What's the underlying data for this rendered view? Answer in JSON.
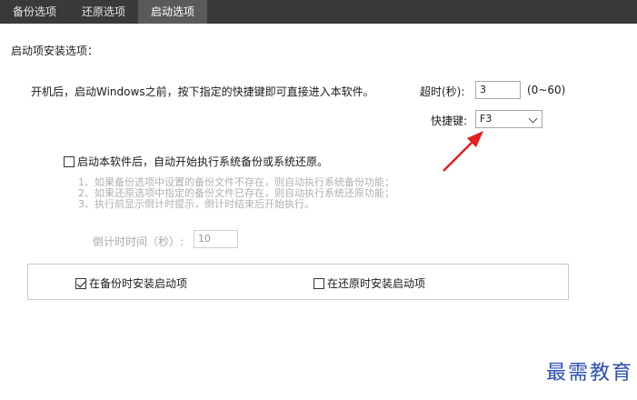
{
  "tabs": [
    {
      "label": "备份选项"
    },
    {
      "label": "还原选项"
    },
    {
      "label": "启动选项"
    }
  ],
  "section_title": "启动项安装选项：",
  "description": "开机后，启动Windows之前，按下指定的快捷键即可直接进入本软件。",
  "timeout": {
    "label": "超时(秒):",
    "value": "3",
    "range": "(0~60)"
  },
  "hotkey": {
    "label": "快捷键:",
    "value": "F3"
  },
  "auto_exec": {
    "label": "启动本软件后，自动开始执行系统备份或系统还原。",
    "checked": false
  },
  "notes": [
    "1、如果备份选项中设置的备份文件不存在，则自动执行系统备份功能；",
    "2、如果还原选项中指定的备份文件已存在，则自动执行系统还原功能；",
    "3、执行前显示倒计时提示，倒计时结束后开始执行。"
  ],
  "countdown": {
    "label": "倒计时时间（秒）:",
    "value": "10"
  },
  "install_on_backup": {
    "label": "在备份时安装启动项",
    "checked": true
  },
  "install_on_restore": {
    "label": "在还原时安装启动项",
    "checked": false
  },
  "watermark": "最需教育",
  "colors": {
    "tabbar": "#3a3a3a",
    "active_tab": "#5a5a5a",
    "arrow": "#e02020",
    "watermark": "#2b4fb0"
  }
}
